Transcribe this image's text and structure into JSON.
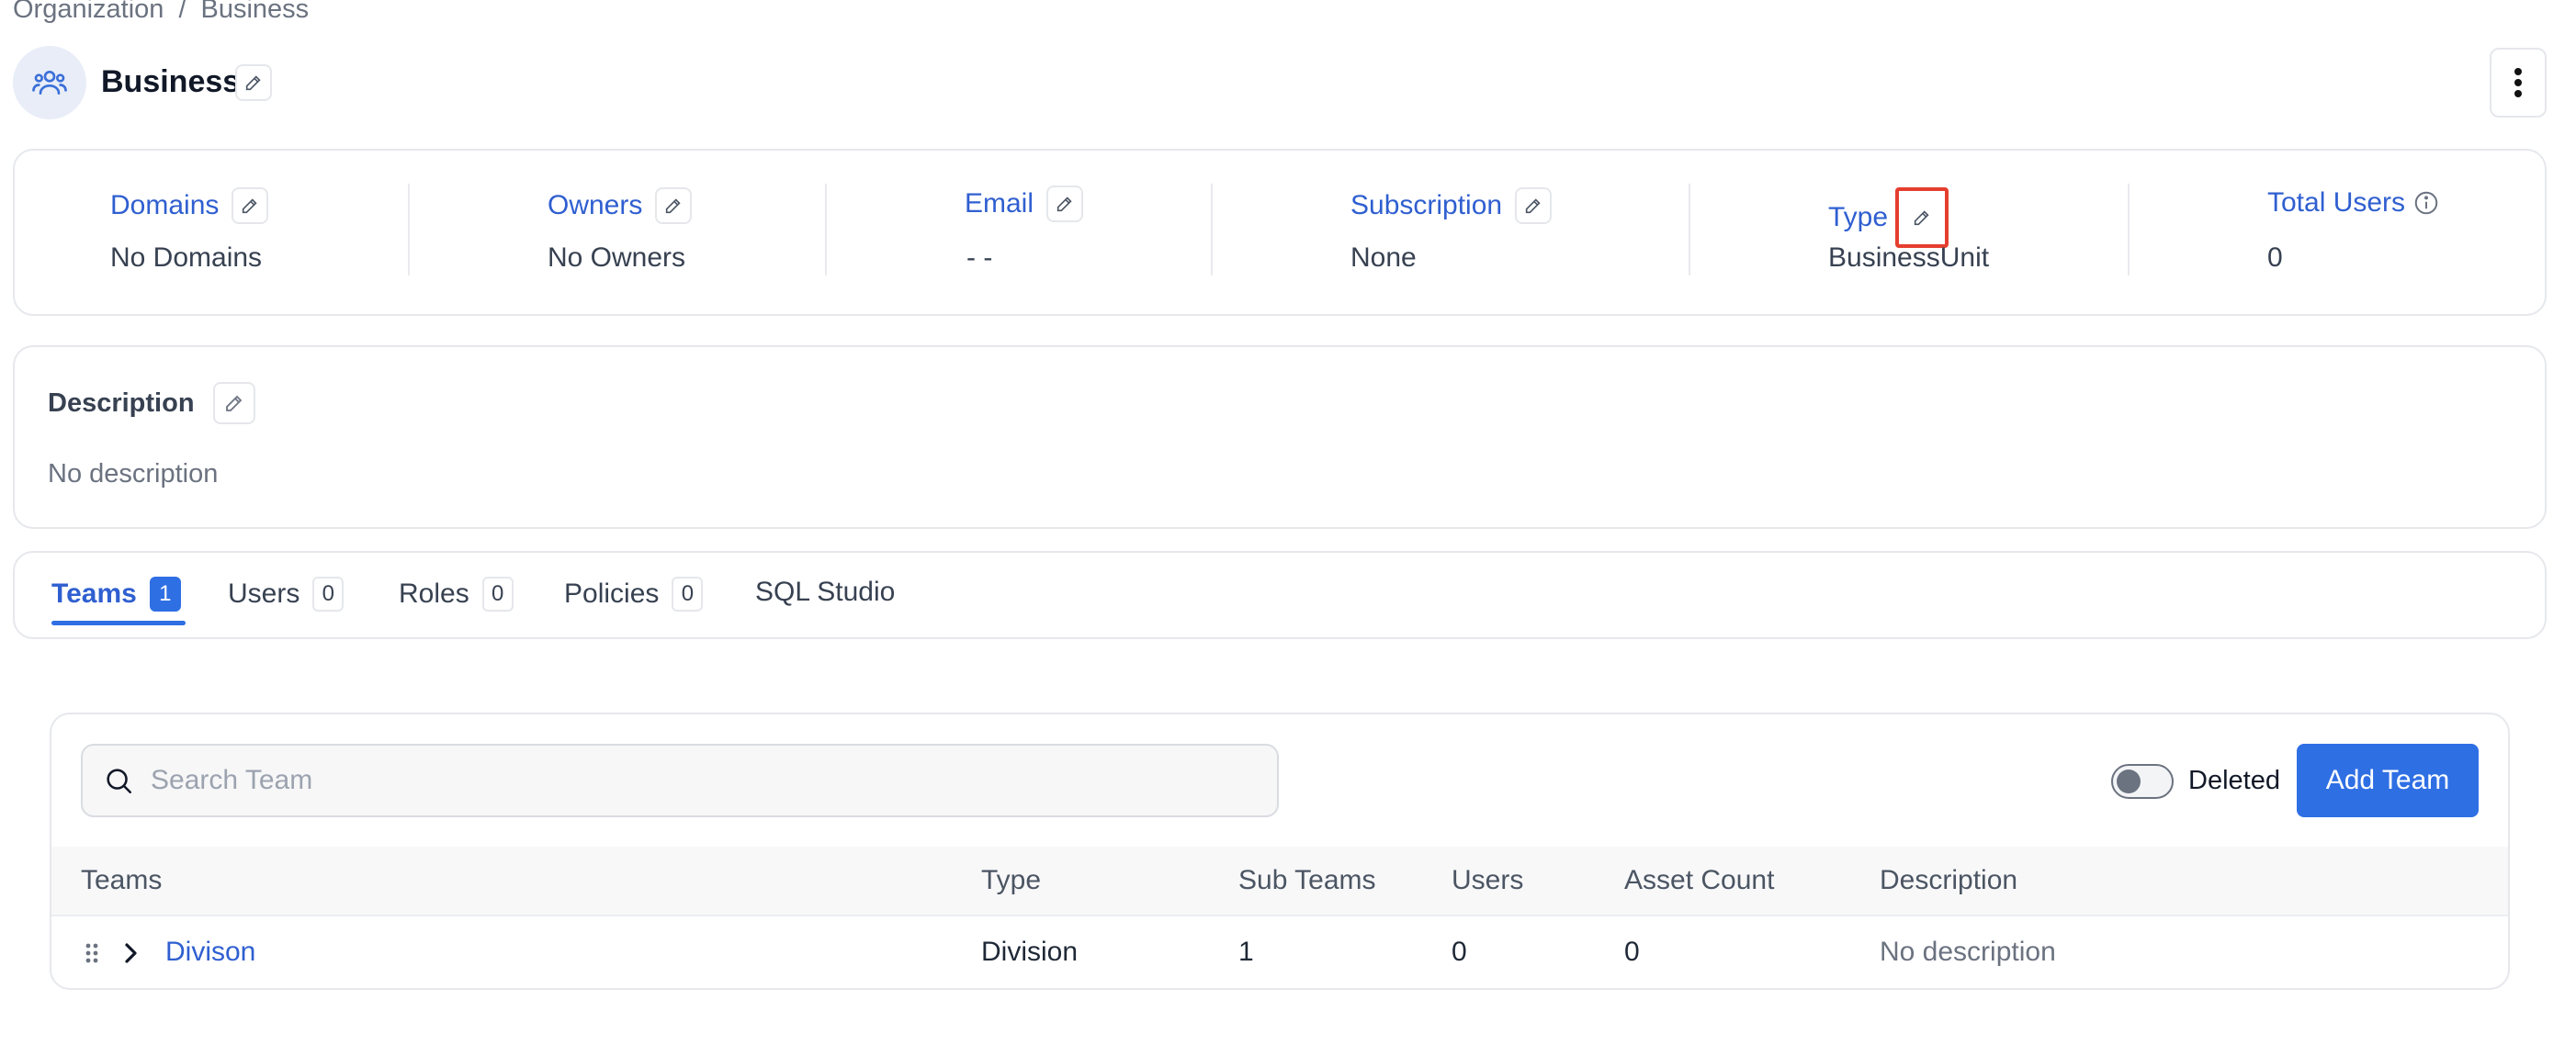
{
  "breadcrumb": {
    "parent": "Organization",
    "separator": "/",
    "current": "Business"
  },
  "header": {
    "title": "Business"
  },
  "stats": [
    {
      "label": "Domains",
      "value": "No Domains"
    },
    {
      "label": "Owners",
      "value": "No Owners"
    },
    {
      "label": "Email",
      "value": "- -"
    },
    {
      "label": "Subscription",
      "value": "None"
    },
    {
      "label": "Type",
      "value": "BusinessUnit"
    },
    {
      "label": "Total Users",
      "value": "0"
    }
  ],
  "description": {
    "title": "Description",
    "text": "No description"
  },
  "tabs": [
    {
      "label": "Teams",
      "count": "1"
    },
    {
      "label": "Users",
      "count": "0"
    },
    {
      "label": "Roles",
      "count": "0"
    },
    {
      "label": "Policies",
      "count": "0"
    },
    {
      "label": "SQL Studio"
    }
  ],
  "search": {
    "placeholder": "Search Team"
  },
  "deleted_toggle": {
    "label": "Deleted",
    "on": false
  },
  "add_button": {
    "label": "Add Team"
  },
  "table": {
    "columns": [
      "Teams",
      "Type",
      "Sub Teams",
      "Users",
      "Asset Count",
      "Description"
    ],
    "rows": [
      {
        "team": "Divison",
        "type": "Division",
        "sub_teams": "1",
        "users": "0",
        "asset_count": "0",
        "description": "No description"
      }
    ]
  },
  "colors": {
    "accent": "#2f6fe4",
    "link": "#2f5fd0",
    "highlight": "#e53e2f"
  }
}
